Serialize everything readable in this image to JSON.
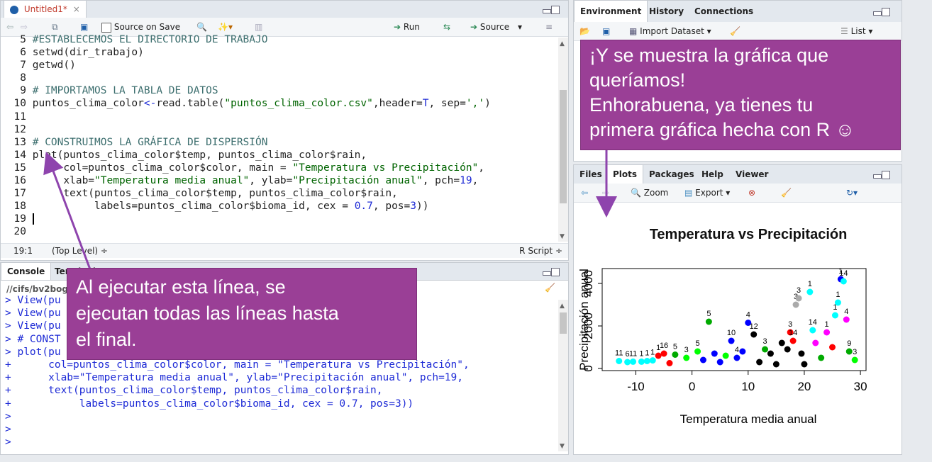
{
  "source": {
    "tab_label": "Untitled1*",
    "toolbar": {
      "source_on_save": "Source on Save",
      "run": "Run",
      "source": "Source"
    },
    "lines": [
      {
        "n": "5",
        "t": "#ESTABLECEMOS EL DIRECTORIO DE TRABAJO"
      },
      {
        "n": "6",
        "t": "setwd(dir_trabajo)"
      },
      {
        "n": "7",
        "t": "getwd()"
      },
      {
        "n": "8",
        "t": ""
      },
      {
        "n": "9",
        "t": "# IMPORTAMOS LA TABLA DE DATOS"
      },
      {
        "n": "10",
        "t": "puntos_clima_color<-read.table(\"puntos_clima_color.csv\",header=T, sep=',')"
      },
      {
        "n": "11",
        "t": ""
      },
      {
        "n": "12",
        "t": ""
      },
      {
        "n": "13",
        "t": "# CONSTRUIMOS LA GRÁFICA DE DISPERSIÓN"
      },
      {
        "n": "14",
        "t": "plot(puntos_clima_color$temp, puntos_clima_color$rain,"
      },
      {
        "n": "15",
        "t": "     col=puntos_clima_color$color, main = \"Temperatura vs Precipitación\","
      },
      {
        "n": "16",
        "t": "     xlab=\"Temperatura media anual\", ylab=\"Precipitación anual\", pch=19,"
      },
      {
        "n": "17",
        "t": "     text(puntos_clima_color$temp, puntos_clima_color$rain,"
      },
      {
        "n": "18",
        "t": "          labels=puntos_clima_color$bioma_id, cex = 0.7, pos=3))"
      },
      {
        "n": "19",
        "t": ""
      },
      {
        "n": "20",
        "t": ""
      }
    ],
    "status": {
      "position": "19:1",
      "scope": "(Top Level) ÷",
      "filetype": "R Script ÷"
    }
  },
  "console": {
    "tabs": [
      "Console",
      "Terminal"
    ],
    "path": "//cifs/bv2bog",
    "lines": [
      "> View(pu",
      "> View(pu",
      "> View(pu",
      "> # CONST",
      "> plot(pu",
      "+      col=puntos_clima_color$color, main = \"Temperatura vs Precipitación\",",
      "+      xlab=\"Temperatura media anual\", ylab=\"Precipitación anual\", pch=19,",
      "+      text(puntos_clima_color$temp, puntos_clima_color$rain,",
      "+           labels=puntos_clima_color$bioma_id, cex = 0.7, pos=3))",
      ">",
      ">",
      "> "
    ]
  },
  "environment": {
    "tabs": [
      "Environment",
      "History",
      "Connections"
    ],
    "import_label": "Import Dataset",
    "list_label": "List"
  },
  "files": {
    "tabs": [
      "Files",
      "Plots",
      "Packages",
      "Help",
      "Viewer"
    ],
    "zoom_label": "Zoom",
    "export_label": "Export"
  },
  "callouts": {
    "top": [
      "¡Y se muestra la gráfica que",
      "queríamos!",
      "Enhorabuena, ya tienes tu",
      "primera gráfica hecha con R ☺"
    ],
    "bottom": [
      "Al ejecutar esta línea, se",
      "ejecutan todas las líneas hasta",
      "el final."
    ]
  },
  "chart_data": {
    "type": "scatter",
    "title": "Temperatura vs Precipitación",
    "xlabel": "Temperatura media anual",
    "ylabel": "Precipitación anual",
    "xlim": [
      -16,
      31
    ],
    "ylim": [
      -100,
      4700
    ],
    "xticks": [
      -10,
      0,
      10,
      20,
      30
    ],
    "yticks": [
      0,
      2000,
      4000
    ],
    "points": [
      {
        "x": -13,
        "y": 350,
        "c": "#00ffff",
        "l": "11"
      },
      {
        "x": -11.5,
        "y": 300,
        "c": "#00ffff",
        "l": "6"
      },
      {
        "x": -10.5,
        "y": 320,
        "c": "#00ffff",
        "l": "11"
      },
      {
        "x": -9,
        "y": 320,
        "c": "#00ffff",
        "l": "1"
      },
      {
        "x": -8,
        "y": 350,
        "c": "#00ffff",
        "l": "1"
      },
      {
        "x": -7,
        "y": 380,
        "c": "#00ffff",
        "l": "1"
      },
      {
        "x": -6,
        "y": 600,
        "c": "#ff0000",
        "l": "1"
      },
      {
        "x": -5,
        "y": 700,
        "c": "#ff0000",
        "l": "16"
      },
      {
        "x": -4,
        "y": 250,
        "c": "#ff0000",
        "l": ""
      },
      {
        "x": -3,
        "y": 650,
        "c": "#00aa00",
        "l": "5"
      },
      {
        "x": -1,
        "y": 500,
        "c": "#00ff00",
        "l": "3"
      },
      {
        "x": 1,
        "y": 800,
        "c": "#00ff00",
        "l": "5"
      },
      {
        "x": 2,
        "y": 400,
        "c": "#0000ff",
        "l": ""
      },
      {
        "x": 3,
        "y": 2200,
        "c": "#00aa00",
        "l": "5"
      },
      {
        "x": 4,
        "y": 700,
        "c": "#0000ff",
        "l": ""
      },
      {
        "x": 5,
        "y": 300,
        "c": "#0000ff",
        "l": ""
      },
      {
        "x": 6,
        "y": 600,
        "c": "#00ff00",
        "l": ""
      },
      {
        "x": 7,
        "y": 1300,
        "c": "#0000ff",
        "l": "10"
      },
      {
        "x": 8,
        "y": 500,
        "c": "#0000ff",
        "l": "4"
      },
      {
        "x": 9,
        "y": 800,
        "c": "#0000ff",
        "l": ""
      },
      {
        "x": 10,
        "y": 2150,
        "c": "#0000ff",
        "l": "4"
      },
      {
        "x": 11,
        "y": 1600,
        "c": "#000000",
        "l": "12"
      },
      {
        "x": 12,
        "y": 300,
        "c": "#000000",
        "l": ""
      },
      {
        "x": 13,
        "y": 900,
        "c": "#00aa00",
        "l": "3"
      },
      {
        "x": 14,
        "y": 700,
        "c": "#000000",
        "l": ""
      },
      {
        "x": 15,
        "y": 200,
        "c": "#000000",
        "l": ""
      },
      {
        "x": 16,
        "y": 1200,
        "c": "#000000",
        "l": ""
      },
      {
        "x": 17,
        "y": 900,
        "c": "#000000",
        "l": ""
      },
      {
        "x": 17.5,
        "y": 1700,
        "c": "#ff0000",
        "l": "3"
      },
      {
        "x": 18,
        "y": 1300,
        "c": "#ff0000",
        "l": "14"
      },
      {
        "x": 18.5,
        "y": 3000,
        "c": "#aaaaaa",
        "l": "3"
      },
      {
        "x": 19,
        "y": 3300,
        "c": "#aaaaaa",
        "l": "3"
      },
      {
        "x": 19.5,
        "y": 700,
        "c": "#000000",
        "l": ""
      },
      {
        "x": 20,
        "y": 200,
        "c": "#000000",
        "l": ""
      },
      {
        "x": 21,
        "y": 3600,
        "c": "#00ffff",
        "l": "1"
      },
      {
        "x": 21.5,
        "y": 1800,
        "c": "#00ffff",
        "l": "14"
      },
      {
        "x": 22,
        "y": 1200,
        "c": "#ff00ff",
        "l": ""
      },
      {
        "x": 23,
        "y": 500,
        "c": "#00aa00",
        "l": ""
      },
      {
        "x": 24,
        "y": 1700,
        "c": "#ff00ff",
        "l": "1"
      },
      {
        "x": 25,
        "y": 1000,
        "c": "#ff0000",
        "l": ""
      },
      {
        "x": 25.5,
        "y": 2500,
        "c": "#00ffff",
        "l": "1"
      },
      {
        "x": 26,
        "y": 3100,
        "c": "#00ffff",
        "l": "1"
      },
      {
        "x": 26.5,
        "y": 4200,
        "c": "#0000ff",
        "l": "1"
      },
      {
        "x": 27,
        "y": 4100,
        "c": "#00ffff",
        "l": "14"
      },
      {
        "x": 27.5,
        "y": 2300,
        "c": "#ff00ff",
        "l": "4"
      },
      {
        "x": 28,
        "y": 800,
        "c": "#00aa00",
        "l": "9"
      },
      {
        "x": 29,
        "y": 400,
        "c": "#00ff00",
        "l": "3"
      }
    ]
  }
}
